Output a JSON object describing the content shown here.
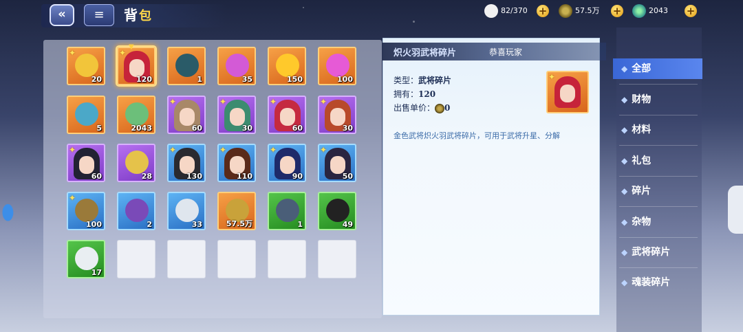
{
  "header": {
    "title_main": "背",
    "title_sub": "包",
    "back_label": "«",
    "bag_label": "≡"
  },
  "resources": [
    {
      "name": "rice",
      "value": "82/370",
      "color": "#f1f1f1"
    },
    {
      "name": "coin",
      "value": "57.5万",
      "color": "#8e7b2e"
    },
    {
      "name": "orb",
      "value": "2043",
      "color": "#45c2a7"
    }
  ],
  "plus_label": "+",
  "slots": [
    {
      "count": "20",
      "tier": "orange",
      "star": true,
      "kind": "item",
      "tint": "#f2c53a"
    },
    {
      "count": "120",
      "tier": "orange",
      "star": true,
      "kind": "hero",
      "tint": "#c6233a",
      "selected": true
    },
    {
      "count": "1",
      "tier": "orange",
      "star": false,
      "kind": "item",
      "tint": "#2a5b68"
    },
    {
      "count": "35",
      "tier": "orange",
      "star": false,
      "kind": "item",
      "tint": "#d35ad6"
    },
    {
      "count": "150",
      "tier": "orange",
      "star": false,
      "kind": "item",
      "tint": "#ffc92b"
    },
    {
      "count": "100",
      "tier": "orange",
      "star": false,
      "kind": "item",
      "tint": "#e65ad6"
    },
    {
      "count": "5",
      "tier": "orange",
      "star": false,
      "kind": "item",
      "tint": "#4ba8c8"
    },
    {
      "count": "2043",
      "tier": "orange",
      "star": false,
      "kind": "item",
      "tint": "#6cbf7a"
    },
    {
      "count": "60",
      "tier": "purple",
      "star": true,
      "kind": "hero",
      "tint": "#a88868"
    },
    {
      "count": "30",
      "tier": "purple",
      "star": true,
      "kind": "hero",
      "tint": "#3c8c70"
    },
    {
      "count": "60",
      "tier": "purple",
      "star": true,
      "kind": "hero",
      "tint": "#c52a40"
    },
    {
      "count": "30",
      "tier": "purple",
      "star": true,
      "kind": "hero",
      "tint": "#b84a2a"
    },
    {
      "count": "60",
      "tier": "purple",
      "star": true,
      "kind": "hero",
      "tint": "#222233"
    },
    {
      "count": "28",
      "tier": "purple",
      "star": false,
      "kind": "item",
      "tint": "#e5c24a"
    },
    {
      "count": "130",
      "tier": "blue",
      "star": true,
      "kind": "hero",
      "tint": "#2a2a30"
    },
    {
      "count": "110",
      "tier": "blue",
      "star": true,
      "kind": "hero",
      "tint": "#5a2a1a"
    },
    {
      "count": "90",
      "tier": "blue",
      "star": true,
      "kind": "hero",
      "tint": "#1e2a6a"
    },
    {
      "count": "50",
      "tier": "blue",
      "star": true,
      "kind": "hero",
      "tint": "#2a2540"
    },
    {
      "count": "100",
      "tier": "blue",
      "star": true,
      "kind": "item",
      "tint": "#9a7a3a"
    },
    {
      "count": "2",
      "tier": "blue",
      "star": false,
      "kind": "item",
      "tint": "#7a4ab8"
    },
    {
      "count": "33",
      "tier": "blue",
      "star": false,
      "kind": "item",
      "tint": "#dfe6ee"
    },
    {
      "count": "57.5万",
      "tier": "orange",
      "star": false,
      "kind": "item",
      "tint": "#c9a23a"
    },
    {
      "count": "1",
      "tier": "green",
      "star": false,
      "kind": "item",
      "tint": "#4a5e78"
    },
    {
      "count": "49",
      "tier": "green",
      "star": false,
      "kind": "item",
      "tint": "#222222"
    },
    {
      "count": "17",
      "tier": "green",
      "star": false,
      "kind": "item",
      "tint": "#e9eef2"
    },
    {
      "count": "",
      "tier": "empty"
    },
    {
      "count": "",
      "tier": "empty"
    },
    {
      "count": "",
      "tier": "empty"
    },
    {
      "count": "",
      "tier": "empty"
    },
    {
      "count": "",
      "tier": "empty"
    }
  ],
  "detail": {
    "name": "炽火羽武将碎片",
    "toast": "恭喜玩家",
    "type_label": "类型：",
    "type_value": "武将碎片",
    "own_label": "拥有：",
    "own_value": "120",
    "price_label": "出售单价：",
    "price_value": "0",
    "description": "金色武将炽火羽武将碎片，可用于武将升星、分解"
  },
  "tabs": [
    "全部",
    "财物",
    "材料",
    "礼包",
    "碎片",
    "杂物",
    "武将碎片",
    "魂装碎片"
  ],
  "active_tab": 0
}
